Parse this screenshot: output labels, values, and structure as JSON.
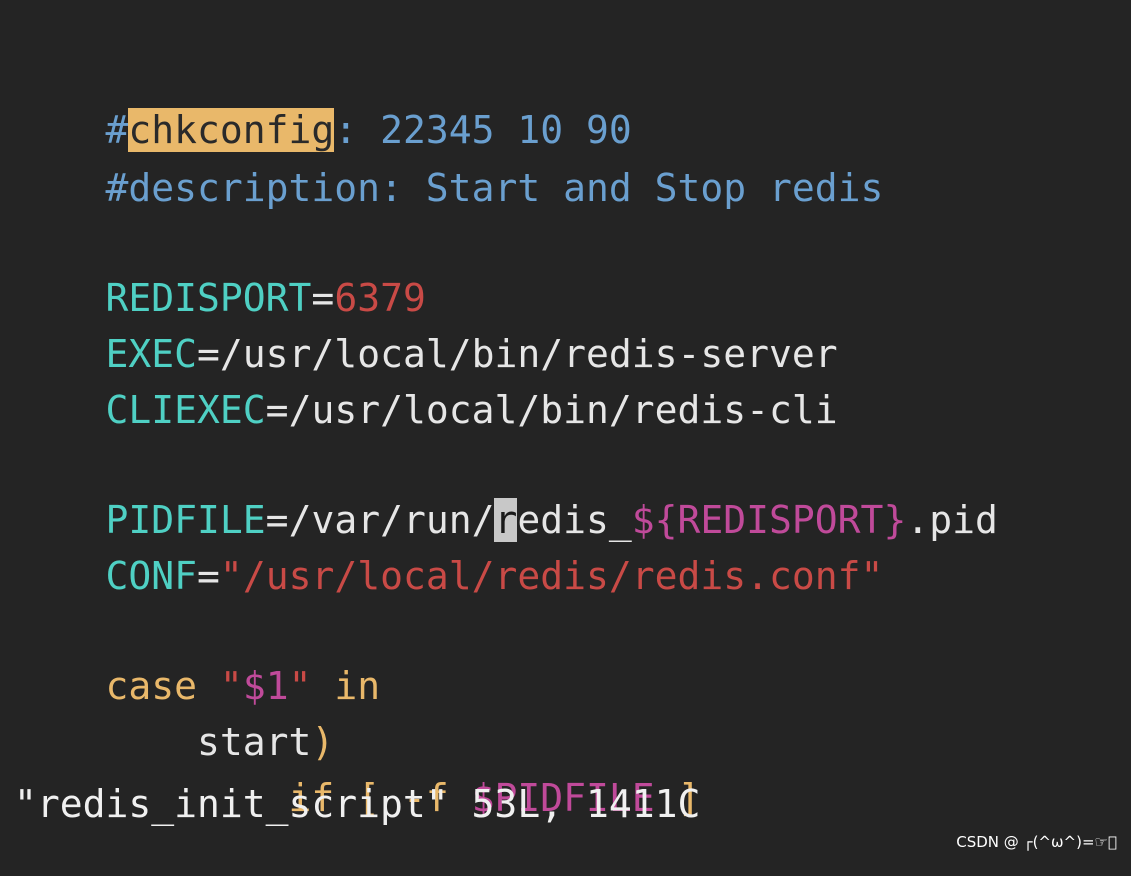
{
  "editor": {
    "lines": {
      "l1": {
        "hash": "#",
        "match": "chkconfig",
        "rest": ": 22345 10 90"
      },
      "l2": {
        "text": "#description: Start and Stop redis"
      },
      "l4": {
        "var": "REDISPORT",
        "eq": "=",
        "val": "6379"
      },
      "l5": {
        "var": "EXEC",
        "eq": "=",
        "val": "/usr/local/bin/redis-server"
      },
      "l6": {
        "var": "CLIEXEC",
        "eq": "=",
        "val": "/usr/local/bin/redis-cli"
      },
      "l8": {
        "var": "PIDFILE",
        "eq": "=",
        "pre": "/var/run/",
        "cursor": "r",
        "post": "edis_",
        "dollar": "$",
        "brace_open": "{",
        "ref": "REDISPORT",
        "brace_close": "}",
        "tail": ".pid"
      },
      "l9": {
        "var": "CONF",
        "eq": "=",
        "q1": "\"",
        "path": "/usr/local/redis/redis.conf",
        "q2": "\""
      },
      "l11": {
        "kw": "case",
        "sp": " ",
        "q1": "\"",
        "arg": "$1",
        "q2": "\"",
        "in": " in"
      },
      "l12": {
        "indent": "    ",
        "label": "start",
        "paren": ")"
      },
      "l13": {
        "indent": "        ",
        "kw": "if",
        "sp": " ",
        "br1": "[",
        "flag": " -f ",
        "ref": "$PIDFILE",
        "br2": " ]"
      }
    },
    "status_line": "\"redis_init_script\" 53L, 1411C"
  },
  "watermark": "CSDN @ ┌(^ω^)=☞\u0000",
  "colors": {
    "background": "#242424",
    "comment": "#6a9fcf",
    "variable": "#4fd0c4",
    "string": "#c94a46",
    "keyword": "#e9b86a",
    "dollar": "#c04a9a",
    "search_highlight": "#e9b86a"
  }
}
